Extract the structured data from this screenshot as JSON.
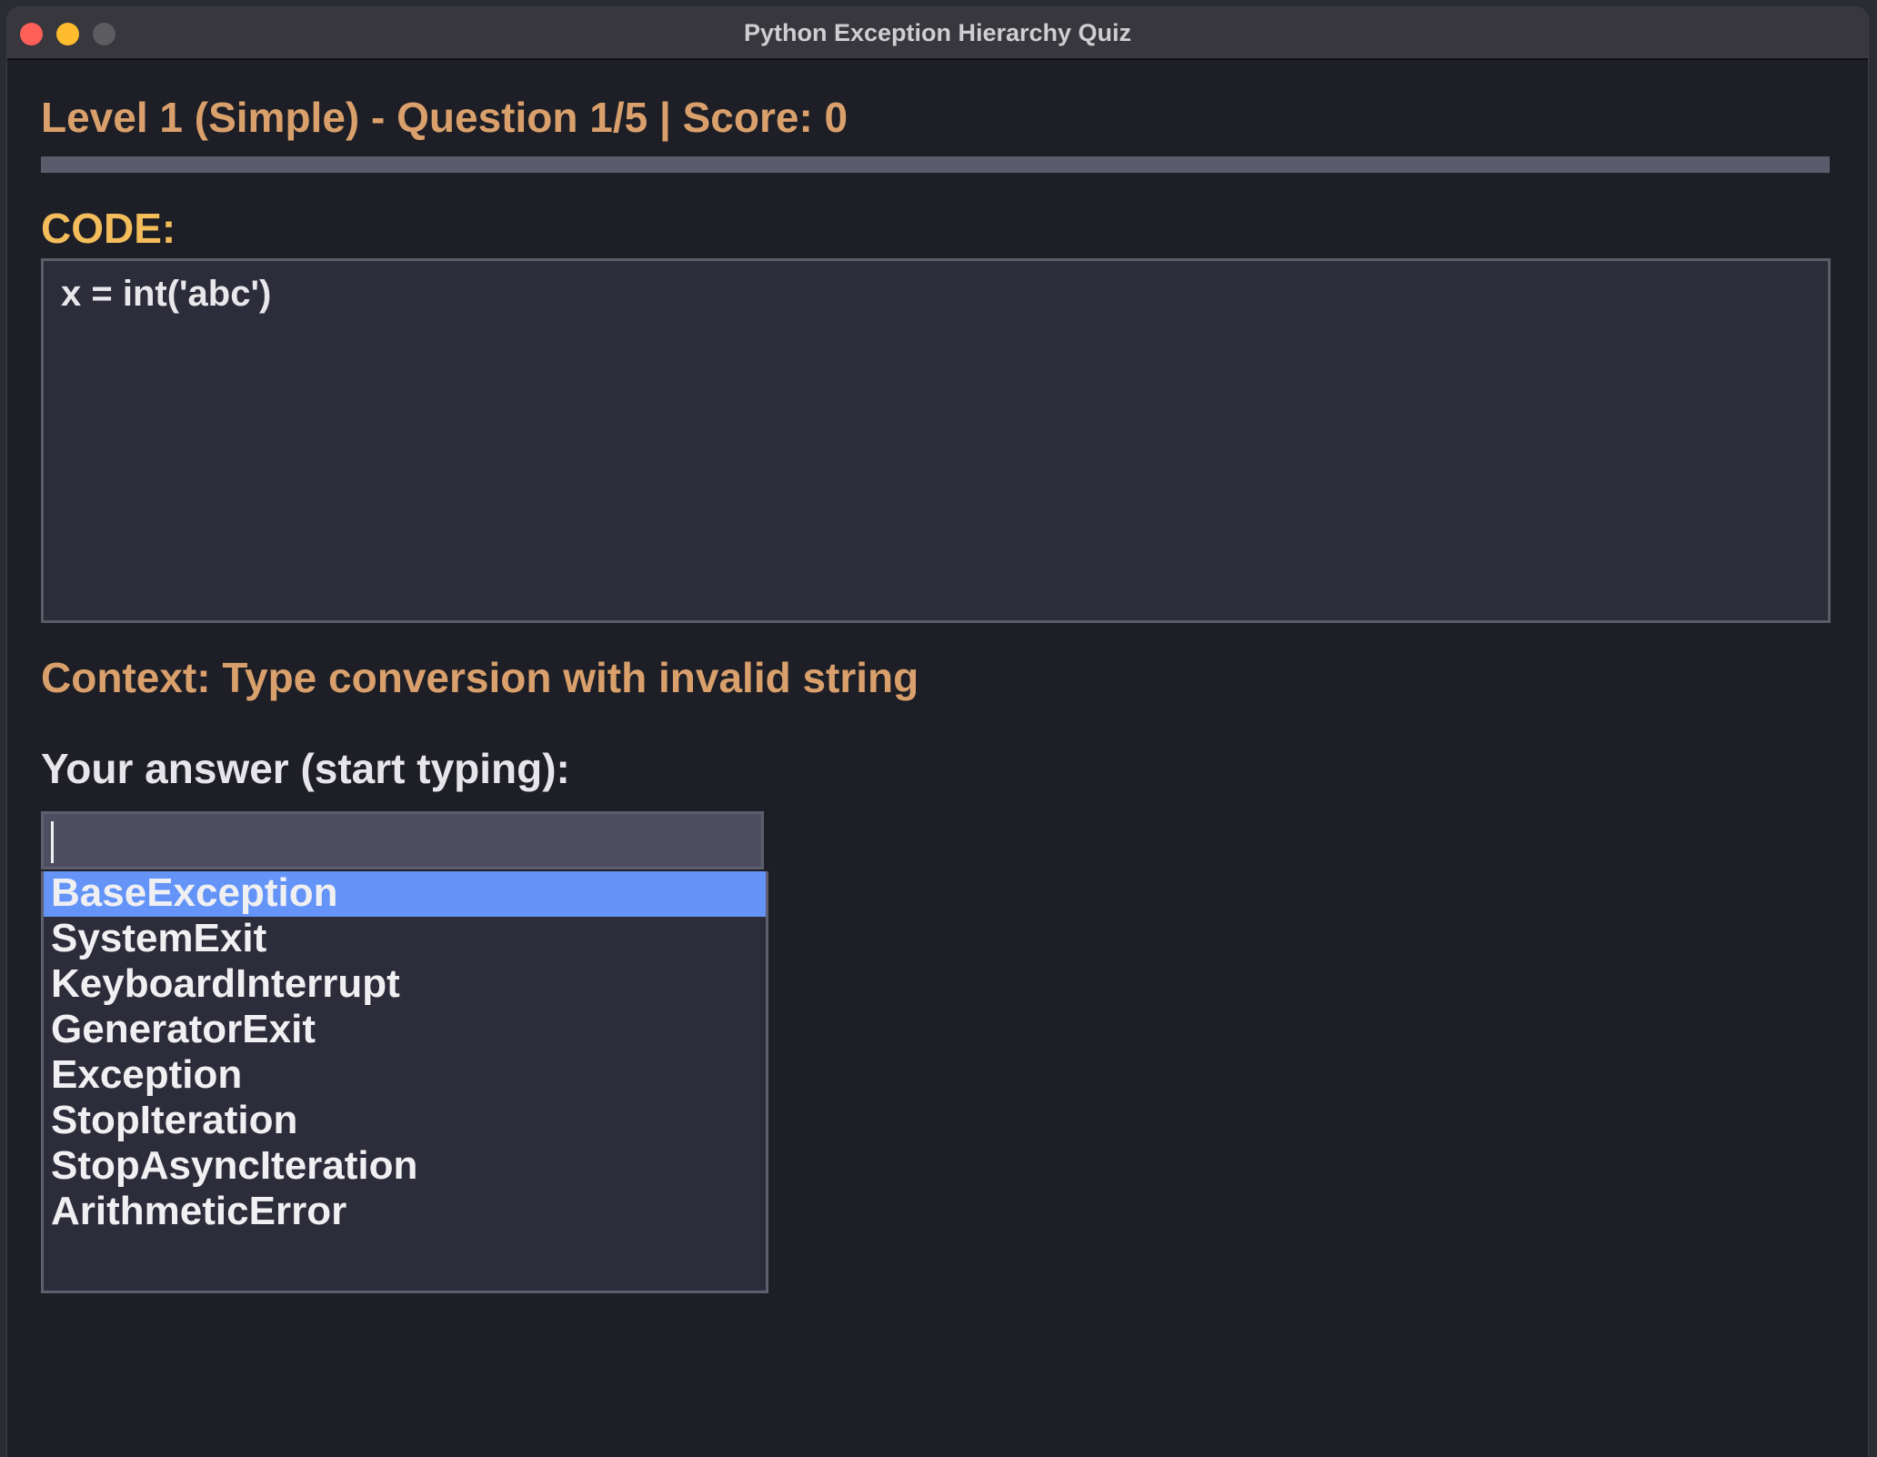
{
  "window": {
    "title": "Python Exception Hierarchy Quiz"
  },
  "status": {
    "text": "Level 1 (Simple) - Question 1/5 | Score: 0",
    "progress_fraction": 0
  },
  "code_section": {
    "heading": "CODE:",
    "code": "x = int('abc')"
  },
  "context": {
    "text": "Context: Type conversion with invalid string"
  },
  "answer": {
    "label": "Your answer (start typing):",
    "input_value": "",
    "suggestions": [
      "BaseException",
      "SystemExit",
      "KeyboardInterrupt",
      "GeneratorExit",
      "Exception",
      "StopIteration",
      "StopAsyncIteration",
      "ArithmeticError"
    ],
    "selected_index": 0
  },
  "colors": {
    "accent_orange": "#d9a06c",
    "heading_yellow": "#f2bd5a",
    "selection_blue": "#6494f7",
    "background": "#1e1e26"
  }
}
